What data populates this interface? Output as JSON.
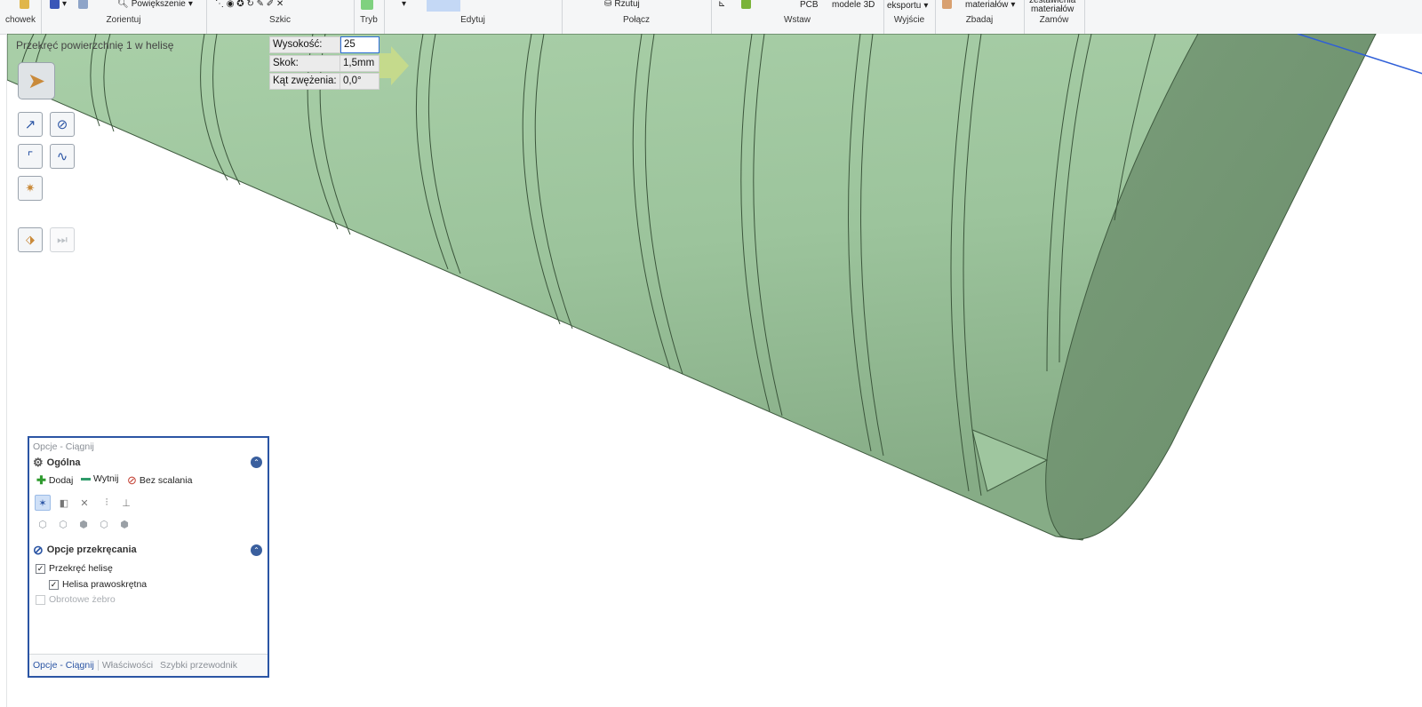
{
  "ribbon": {
    "groups": [
      {
        "label": "chowek"
      },
      {
        "label": "Zorientuj",
        "items": [
          "Powiększenie"
        ]
      },
      {
        "label": "Szkic"
      },
      {
        "label": "Tryb"
      },
      {
        "label": "Edytuj"
      },
      {
        "label": "Połącz",
        "items": [
          "Rzutuj"
        ]
      },
      {
        "label": "Wstaw",
        "items": [
          "PCB",
          "modele 3D"
        ]
      },
      {
        "label": "Wyjście",
        "items": [
          "eksportu"
        ]
      },
      {
        "label": "Zbadaj",
        "items": [
          "materiałów"
        ]
      },
      {
        "label": "Zamów",
        "items": [
          "zestawienia",
          "materiałów"
        ]
      }
    ]
  },
  "viewport": {
    "tool_title": "Przekręć powierzchnię 1 w helisę",
    "fields": [
      {
        "label": "Wysokość:",
        "value": "25",
        "active": true
      },
      {
        "label": "Skok:",
        "value": "1,5mm",
        "active": false
      },
      {
        "label": "Kąt zwężenia:",
        "value": "0,0°",
        "active": false
      }
    ],
    "model_color": "#a3c8a3",
    "axis_color": "#2f5fd8"
  },
  "panel": {
    "title": "Opcje - Ciągnij",
    "general": {
      "title": "Ogólna",
      "actions": {
        "add": "Dodaj",
        "cut": "Wytnij",
        "nomerge": "Bez scalania"
      }
    },
    "twist": {
      "title": "Opcje przekręcania",
      "options": [
        {
          "label": "Przekręć helisę",
          "checked": true,
          "enabled": true
        },
        {
          "label": "Helisa prawoskrętna",
          "checked": true,
          "enabled": true
        },
        {
          "label": "Obrotowe żebro",
          "checked": false,
          "enabled": false
        }
      ]
    },
    "tabs": [
      "Opcje - Ciągnij",
      "Właściwości",
      "Szybki przewodnik"
    ]
  }
}
